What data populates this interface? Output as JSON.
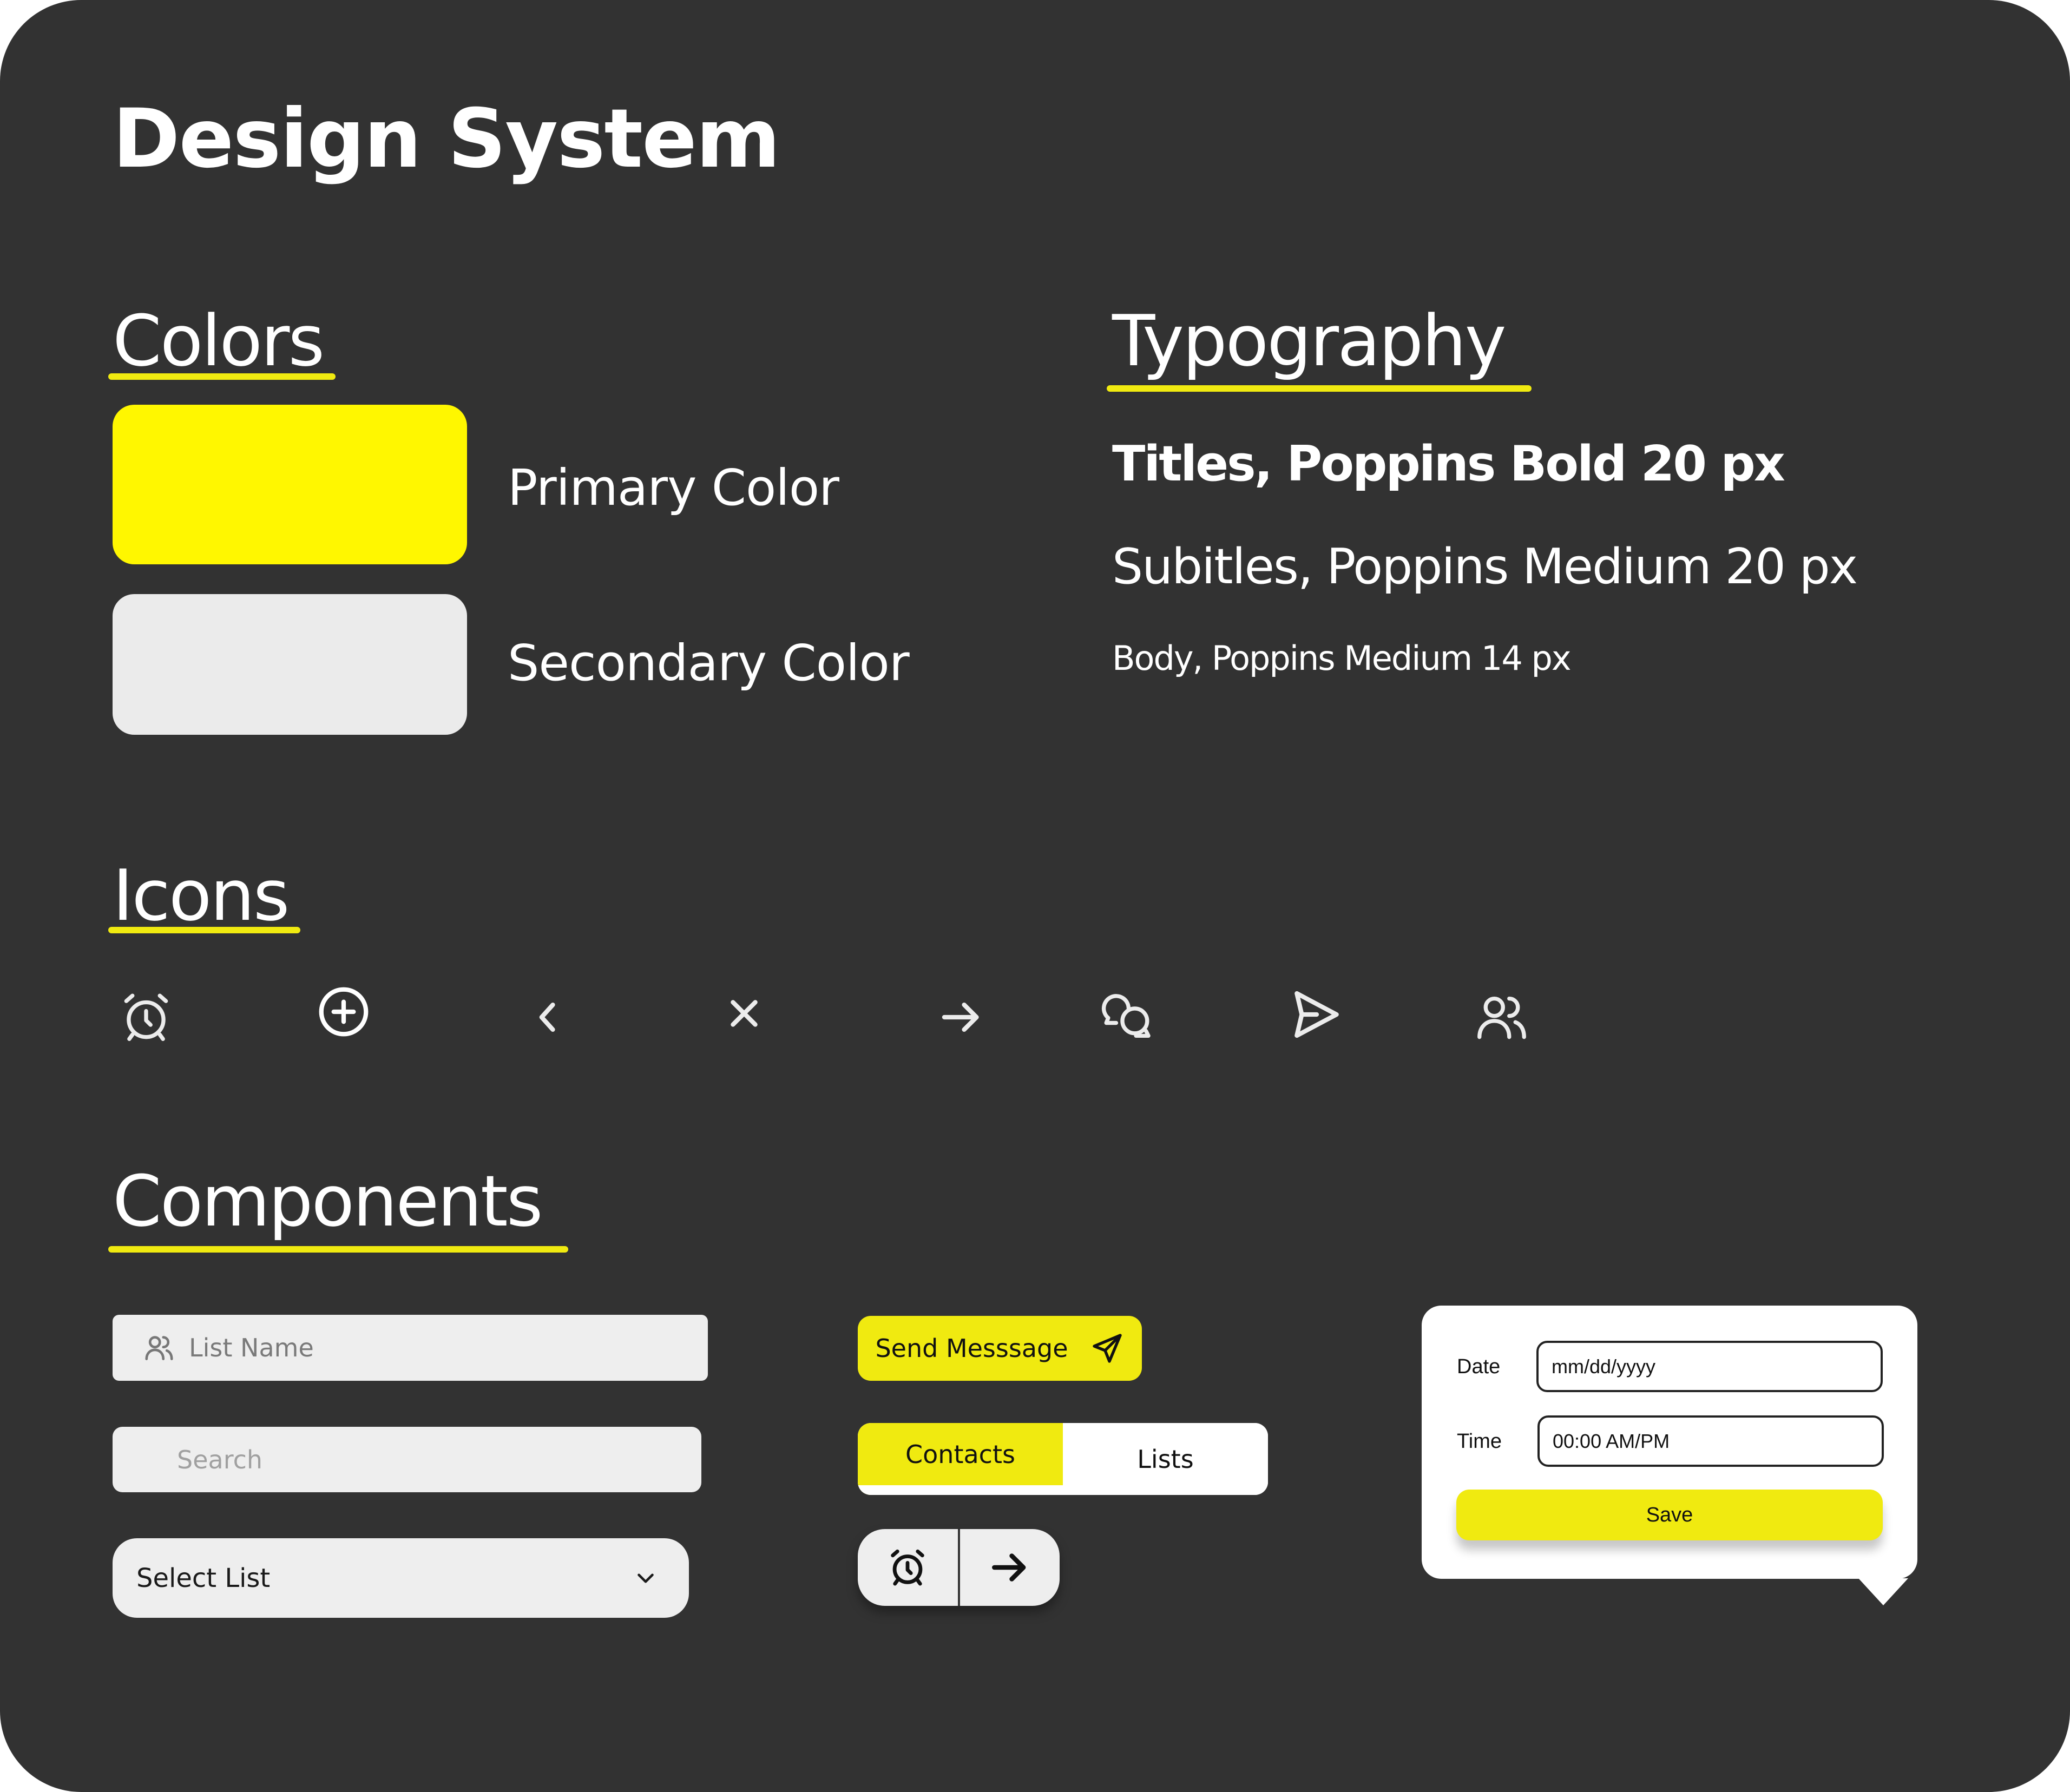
{
  "page": {
    "title": "Design System"
  },
  "colors": {
    "heading": "Colors",
    "accent": "#f0ea10",
    "swatches": [
      {
        "label": "Primary Color",
        "hex": "#fff700"
      },
      {
        "label": "Secondary Color",
        "hex": "#ebebeb"
      }
    ]
  },
  "typography": {
    "heading": "Typography",
    "samples": [
      {
        "label": "Titles, Poppins Bold 20 px"
      },
      {
        "label": "Subitles, Poppins Medium 20 px"
      },
      {
        "label": "Body, Poppins Medium 14 px"
      }
    ]
  },
  "icons": {
    "heading": "Icons",
    "items": [
      "alarm-clock",
      "plus-circle",
      "chevron-left",
      "close-x",
      "arrow-right",
      "chat-bubbles",
      "send-triangle",
      "users"
    ]
  },
  "components": {
    "heading": "Components",
    "list_name": {
      "placeholder": "List Name"
    },
    "search": {
      "placeholder": "Search"
    },
    "select": {
      "value": "Select List"
    },
    "send_button": {
      "label": "Send Messsage"
    },
    "tabs": [
      {
        "label": "Contacts",
        "active": true
      },
      {
        "label": "Lists",
        "active": false
      }
    ],
    "popup": {
      "date_label": "Date",
      "date_placeholder": "mm/dd/yyyy",
      "time_label": "Time",
      "time_placeholder": "00:00 AM/PM",
      "save_label": "Save"
    }
  }
}
